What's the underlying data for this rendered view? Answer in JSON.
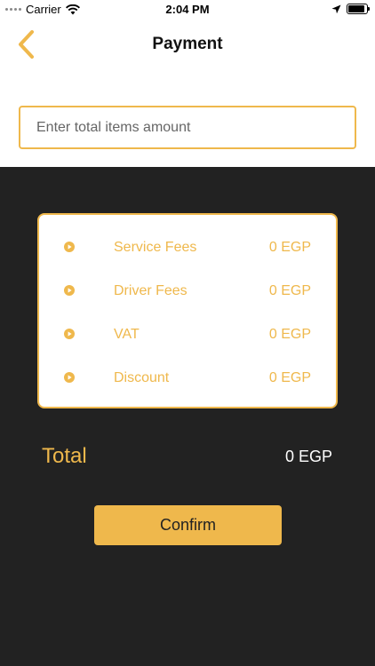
{
  "status_bar": {
    "carrier": "Carrier",
    "time": "2:04 PM",
    "battery_level": 0.9
  },
  "header": {
    "title": "Payment",
    "back_icon": "chevron-left-icon"
  },
  "amount_input": {
    "placeholder": "Enter total items amount",
    "value": ""
  },
  "fees": {
    "items": [
      {
        "label": "Service Fees",
        "value": "0 EGP",
        "icon": "play-circle-icon"
      },
      {
        "label": "Driver Fees",
        "value": "0 EGP",
        "icon": "play-circle-icon"
      },
      {
        "label": "VAT",
        "value": "0 EGP",
        "icon": "play-circle-icon"
      },
      {
        "label": "Discount",
        "value": "0 EGP",
        "icon": "play-circle-icon"
      }
    ]
  },
  "total": {
    "label": "Total",
    "value": "0 EGP"
  },
  "confirm_button": {
    "label": "Confirm"
  },
  "colors": {
    "accent": "#EFB84C",
    "dark_background": "#222222",
    "card_background": "#FFFFFF"
  }
}
